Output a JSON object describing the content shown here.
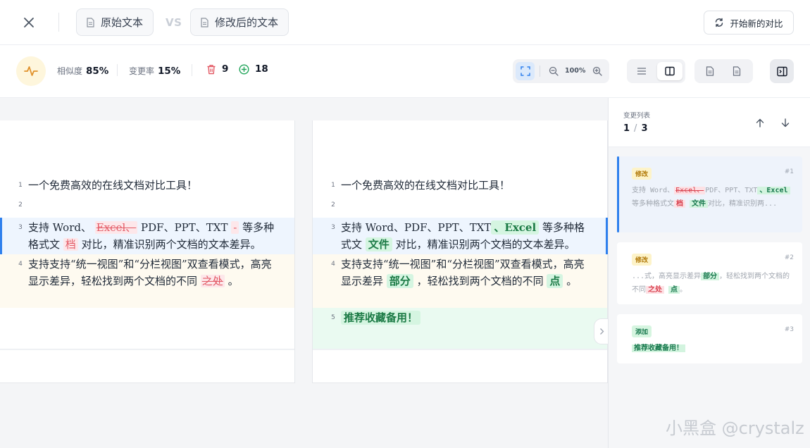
{
  "header": {
    "original_label": "原始文本",
    "modified_label": "修改后的文本",
    "vs_label": "VS",
    "new_compare_label": "开始新的对比"
  },
  "stats": {
    "similarity_label": "相似度",
    "similarity_value": "85%",
    "change_rate_label": "变更率",
    "change_rate_value": "15%",
    "deletions": "9",
    "additions": "18",
    "zoom": "100%"
  },
  "left_pane": {
    "lines": [
      {
        "n": "1",
        "text": "一个免费高效的在线文档对比工具！"
      },
      {
        "n": "2"
      },
      {
        "n": "3",
        "a": "支持 Word、",
        "del": "Excel、",
        "b": "PDF、PPT、TXT",
        "del2": "-",
        "c": "等多种格式文",
        "del3": "档",
        "d": "对比，精准识别两个文档的文本差异。"
      },
      {
        "n": "4",
        "a": "支持支持“统一视图”和“分栏视图”双查看模式，高亮显示差异，轻松找到两个文档的不同",
        "del": "之处",
        "b": "。"
      }
    ]
  },
  "right_pane": {
    "lines": [
      {
        "n": "1",
        "text": "一个免费高效的在线文档对比工具！"
      },
      {
        "n": "2"
      },
      {
        "n": "3",
        "a": "支持 Word、PDF、PPT、TXT",
        "ins": "、Excel",
        "b": "等多种格式文",
        "ins2": "文件",
        "c": "对比，精准识别两个文档的文本差异。"
      },
      {
        "n": "4",
        "a": "支持支持“统一视图”和“分栏视图”双查看模式，高亮显示差异",
        "ins": "部分",
        "b": "，轻松找到两个文档的不同",
        "ins2": "点",
        "c": "。"
      },
      {
        "n": "5",
        "ins": "推荐收藏备用！"
      }
    ]
  },
  "sidebar": {
    "title": "变更列表",
    "current": "1",
    "total": "3",
    "cards": [
      {
        "tag": "修改",
        "num": "#1",
        "a": "支持 Word、",
        "del": "Excel、",
        "b": "PDF、PPT、TXT",
        "ins": "、Excel",
        "c": "等多种格式文",
        "del2": "档",
        "ins2": "文件",
        "d": "对比，精准识别两..."
      },
      {
        "tag": "修改",
        "num": "#2",
        "a": "...式，高亮显示差异",
        "ins": "部分",
        "b": "，轻松找到两个文档的不同",
        "del": "之处",
        "ins2": "点",
        "c": "。"
      },
      {
        "tag": "添加",
        "num": "#3",
        "ins": "推荐收藏备用！"
      }
    ]
  },
  "watermark": "小黑盒 @crystalz",
  "colors": {
    "accent_blue": "#2f80ed",
    "deleted_red": "#e35b66",
    "inserted_green": "#1b7a45",
    "modified_tag": "#b07706"
  }
}
